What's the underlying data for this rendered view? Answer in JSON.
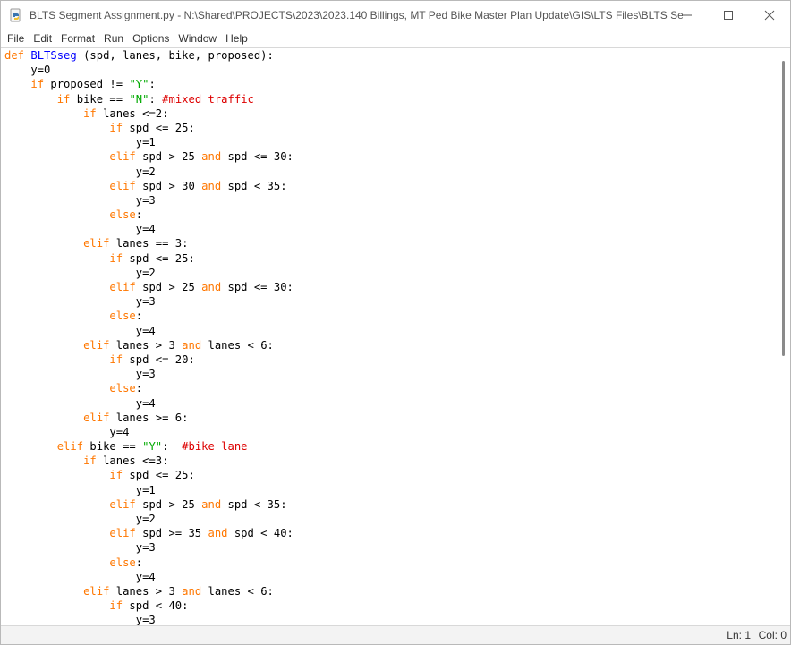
{
  "window": {
    "title": "BLTS Segment Assignment.py - N:\\Shared\\PROJECTS\\2023\\2023.140 Billings, MT Ped Bike Master Plan Update\\GIS\\LTS Files\\BLTS Se..."
  },
  "menu": [
    "File",
    "Edit",
    "Format",
    "Run",
    "Options",
    "Window",
    "Help"
  ],
  "colors": {
    "keyword": "#ff7700",
    "definition": "#0000ff",
    "string": "#00aa00",
    "comment": "#dd0000"
  },
  "code_lines": [
    [
      [
        "def",
        "kw"
      ],
      [
        " "
      ],
      [
        "BLTSseg",
        "def"
      ],
      [
        " (spd, lanes, bike, proposed):"
      ]
    ],
    [
      [
        "    y=0"
      ]
    ],
    [
      [
        "    "
      ],
      [
        "if",
        "kw"
      ],
      [
        " proposed != "
      ],
      [
        "\"Y\"",
        "str"
      ],
      [
        ":"
      ]
    ],
    [
      [
        "        "
      ],
      [
        "if",
        "kw"
      ],
      [
        " bike == "
      ],
      [
        "\"N\"",
        "str"
      ],
      [
        ": "
      ],
      [
        "#mixed traffic",
        "com"
      ]
    ],
    [
      [
        "            "
      ],
      [
        "if",
        "kw"
      ],
      [
        " lanes <=2:"
      ]
    ],
    [
      [
        "                "
      ],
      [
        "if",
        "kw"
      ],
      [
        " spd <= 25:"
      ]
    ],
    [
      [
        "                    y=1"
      ]
    ],
    [
      [
        "                "
      ],
      [
        "elif",
        "kw"
      ],
      [
        " spd > 25 "
      ],
      [
        "and",
        "kw"
      ],
      [
        " spd <= 30:"
      ]
    ],
    [
      [
        "                    y=2"
      ]
    ],
    [
      [
        "                "
      ],
      [
        "elif",
        "kw"
      ],
      [
        " spd > 30 "
      ],
      [
        "and",
        "kw"
      ],
      [
        " spd < 35:"
      ]
    ],
    [
      [
        "                    y=3"
      ]
    ],
    [
      [
        "                "
      ],
      [
        "else",
        "kw"
      ],
      [
        ":"
      ]
    ],
    [
      [
        "                    y=4"
      ]
    ],
    [
      [
        "            "
      ],
      [
        "elif",
        "kw"
      ],
      [
        " lanes == 3:"
      ]
    ],
    [
      [
        "                "
      ],
      [
        "if",
        "kw"
      ],
      [
        " spd <= 25:"
      ]
    ],
    [
      [
        "                    y=2"
      ]
    ],
    [
      [
        "                "
      ],
      [
        "elif",
        "kw"
      ],
      [
        " spd > 25 "
      ],
      [
        "and",
        "kw"
      ],
      [
        " spd <= 30:"
      ]
    ],
    [
      [
        "                    y=3"
      ]
    ],
    [
      [
        "                "
      ],
      [
        "else",
        "kw"
      ],
      [
        ":"
      ]
    ],
    [
      [
        "                    y=4"
      ]
    ],
    [
      [
        "            "
      ],
      [
        "elif",
        "kw"
      ],
      [
        " lanes > 3 "
      ],
      [
        "and",
        "kw"
      ],
      [
        " lanes < 6:"
      ]
    ],
    [
      [
        "                "
      ],
      [
        "if",
        "kw"
      ],
      [
        " spd <= 20:"
      ]
    ],
    [
      [
        "                    y=3"
      ]
    ],
    [
      [
        "                "
      ],
      [
        "else",
        "kw"
      ],
      [
        ":"
      ]
    ],
    [
      [
        "                    y=4"
      ]
    ],
    [
      [
        "            "
      ],
      [
        "elif",
        "kw"
      ],
      [
        " lanes >= 6:"
      ]
    ],
    [
      [
        "                y=4"
      ]
    ],
    [
      [
        "        "
      ],
      [
        "elif",
        "kw"
      ],
      [
        " bike == "
      ],
      [
        "\"Y\"",
        "str"
      ],
      [
        ":  "
      ],
      [
        "#bike lane",
        "com"
      ]
    ],
    [
      [
        "            "
      ],
      [
        "if",
        "kw"
      ],
      [
        " lanes <=3:"
      ]
    ],
    [
      [
        "                "
      ],
      [
        "if",
        "kw"
      ],
      [
        " spd <= 25:"
      ]
    ],
    [
      [
        "                    y=1"
      ]
    ],
    [
      [
        "                "
      ],
      [
        "elif",
        "kw"
      ],
      [
        " spd > 25 "
      ],
      [
        "and",
        "kw"
      ],
      [
        " spd < 35:"
      ]
    ],
    [
      [
        "                    y=2"
      ]
    ],
    [
      [
        "                "
      ],
      [
        "elif",
        "kw"
      ],
      [
        " spd >= 35 "
      ],
      [
        "and",
        "kw"
      ],
      [
        " spd < 40:"
      ]
    ],
    [
      [
        "                    y=3"
      ]
    ],
    [
      [
        "                "
      ],
      [
        "else",
        "kw"
      ],
      [
        ":"
      ]
    ],
    [
      [
        "                    y=4"
      ]
    ],
    [
      [
        "            "
      ],
      [
        "elif",
        "kw"
      ],
      [
        " lanes > 3 "
      ],
      [
        "and",
        "kw"
      ],
      [
        " lanes < 6:"
      ]
    ],
    [
      [
        "                "
      ],
      [
        "if",
        "kw"
      ],
      [
        " spd < 40:"
      ]
    ],
    [
      [
        "                    y=3"
      ]
    ]
  ],
  "status": {
    "line": "Ln: 1",
    "col": "Col: 0"
  },
  "icons": {
    "app": "python-file-icon",
    "minimize": "minimize-icon",
    "maximize": "maximize-icon",
    "close": "close-icon"
  }
}
